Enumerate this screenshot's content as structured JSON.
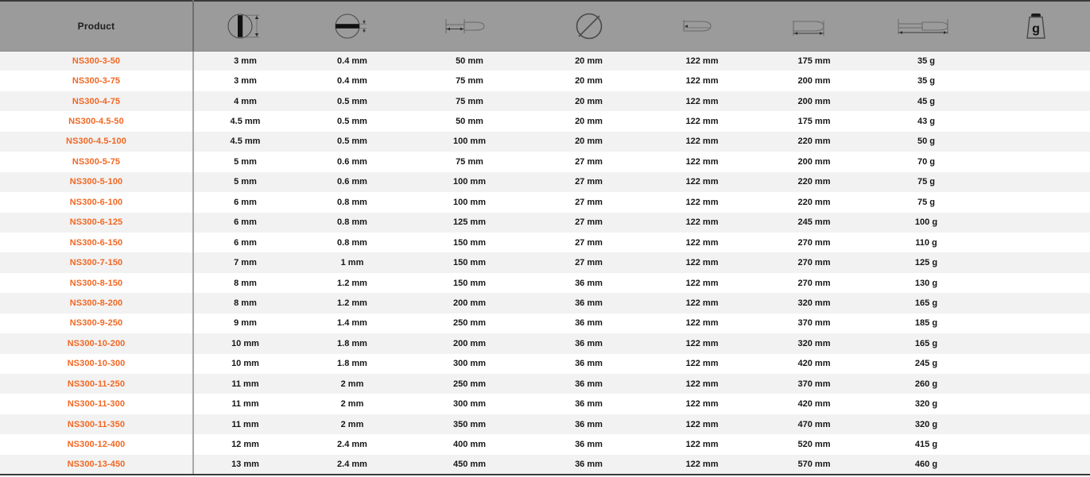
{
  "table": {
    "product_header": "Product",
    "icon_columns": [
      {
        "name": "blade-width-icon",
        "title": "Blade width"
      },
      {
        "name": "blade-thickness-icon",
        "title": "Blade thickness"
      },
      {
        "name": "blade-length-icon",
        "title": "Blade length"
      },
      {
        "name": "shaft-diameter-icon",
        "title": "Shaft diameter"
      },
      {
        "name": "handle-diameter-icon",
        "title": "Handle diameter"
      },
      {
        "name": "handle-length-icon",
        "title": "Handle length"
      },
      {
        "name": "total-length-icon",
        "title": "Total length"
      },
      {
        "name": "weight-icon",
        "title": "Weight",
        "label": "g"
      }
    ],
    "rows": [
      {
        "product": "NS300-3-50",
        "c1": "3 mm",
        "c2": "0.4 mm",
        "c3": "50 mm",
        "c4": "20 mm",
        "c5": "122 mm",
        "c6": "175 mm",
        "c7": "35 g"
      },
      {
        "product": "NS300-3-75",
        "c1": "3 mm",
        "c2": "0.4 mm",
        "c3": "75 mm",
        "c4": "20 mm",
        "c5": "122 mm",
        "c6": "200 mm",
        "c7": "35 g"
      },
      {
        "product": "NS300-4-75",
        "c1": "4 mm",
        "c2": "0.5 mm",
        "c3": "75 mm",
        "c4": "20 mm",
        "c5": "122 mm",
        "c6": "200 mm",
        "c7": "45 g"
      },
      {
        "product": "NS300-4.5-50",
        "c1": "4.5 mm",
        "c2": "0.5 mm",
        "c3": "50 mm",
        "c4": "20 mm",
        "c5": "122 mm",
        "c6": "175 mm",
        "c7": "43 g"
      },
      {
        "product": "NS300-4.5-100",
        "c1": "4.5 mm",
        "c2": "0.5 mm",
        "c3": "100 mm",
        "c4": "20 mm",
        "c5": "122 mm",
        "c6": "220 mm",
        "c7": "50 g"
      },
      {
        "product": "NS300-5-75",
        "c1": "5 mm",
        "c2": "0.6 mm",
        "c3": "75 mm",
        "c4": "27 mm",
        "c5": "122 mm",
        "c6": "200 mm",
        "c7": "70 g"
      },
      {
        "product": "NS300-5-100",
        "c1": "5 mm",
        "c2": "0.6 mm",
        "c3": "100 mm",
        "c4": "27 mm",
        "c5": "122 mm",
        "c6": "220 mm",
        "c7": "75 g"
      },
      {
        "product": "NS300-6-100",
        "c1": "6 mm",
        "c2": "0.8 mm",
        "c3": "100 mm",
        "c4": "27 mm",
        "c5": "122 mm",
        "c6": "220 mm",
        "c7": "75 g"
      },
      {
        "product": "NS300-6-125",
        "c1": "6 mm",
        "c2": "0.8 mm",
        "c3": "125 mm",
        "c4": "27 mm",
        "c5": "122 mm",
        "c6": "245 mm",
        "c7": "100 g"
      },
      {
        "product": "NS300-6-150",
        "c1": "6 mm",
        "c2": "0.8 mm",
        "c3": "150 mm",
        "c4": "27 mm",
        "c5": "122 mm",
        "c6": "270 mm",
        "c7": "110 g"
      },
      {
        "product": "NS300-7-150",
        "c1": "7 mm",
        "c2": "1 mm",
        "c3": "150 mm",
        "c4": "27 mm",
        "c5": "122 mm",
        "c6": "270 mm",
        "c7": "125 g"
      },
      {
        "product": "NS300-8-150",
        "c1": "8 mm",
        "c2": "1.2 mm",
        "c3": "150 mm",
        "c4": "36 mm",
        "c5": "122 mm",
        "c6": "270 mm",
        "c7": "130 g"
      },
      {
        "product": "NS300-8-200",
        "c1": "8 mm",
        "c2": "1.2 mm",
        "c3": "200 mm",
        "c4": "36 mm",
        "c5": "122 mm",
        "c6": "320 mm",
        "c7": "165 g"
      },
      {
        "product": "NS300-9-250",
        "c1": "9 mm",
        "c2": "1.4 mm",
        "c3": "250 mm",
        "c4": "36 mm",
        "c5": "122 mm",
        "c6": "370 mm",
        "c7": "185 g"
      },
      {
        "product": "NS300-10-200",
        "c1": "10 mm",
        "c2": "1.8 mm",
        "c3": "200 mm",
        "c4": "36 mm",
        "c5": "122 mm",
        "c6": "320 mm",
        "c7": "165 g"
      },
      {
        "product": "NS300-10-300",
        "c1": "10 mm",
        "c2": "1.8 mm",
        "c3": "300 mm",
        "c4": "36 mm",
        "c5": "122 mm",
        "c6": "420 mm",
        "c7": "245 g"
      },
      {
        "product": "NS300-11-250",
        "c1": "11 mm",
        "c2": "2 mm",
        "c3": "250 mm",
        "c4": "36 mm",
        "c5": "122 mm",
        "c6": "370 mm",
        "c7": "260 g"
      },
      {
        "product": "NS300-11-300",
        "c1": "11 mm",
        "c2": "2 mm",
        "c3": "300 mm",
        "c4": "36 mm",
        "c5": "122 mm",
        "c6": "420 mm",
        "c7": "320 g"
      },
      {
        "product": "NS300-11-350",
        "c1": "11 mm",
        "c2": "2 mm",
        "c3": "350 mm",
        "c4": "36 mm",
        "c5": "122 mm",
        "c6": "470 mm",
        "c7": "320 g"
      },
      {
        "product": "NS300-12-400",
        "c1": "12 mm",
        "c2": "2.4 mm",
        "c3": "400 mm",
        "c4": "36 mm",
        "c5": "122 mm",
        "c6": "520 mm",
        "c7": "415 g"
      },
      {
        "product": "NS300-13-450",
        "c1": "13 mm",
        "c2": "2.4 mm",
        "c3": "450 mm",
        "c4": "36 mm",
        "c5": "122 mm",
        "c6": "570 mm",
        "c7": "460 g"
      }
    ]
  },
  "colors": {
    "accent": "#f26722",
    "header_bg": "#9b9b9b",
    "row_alt_bg": "#f2f2f2",
    "text": "#161616"
  }
}
